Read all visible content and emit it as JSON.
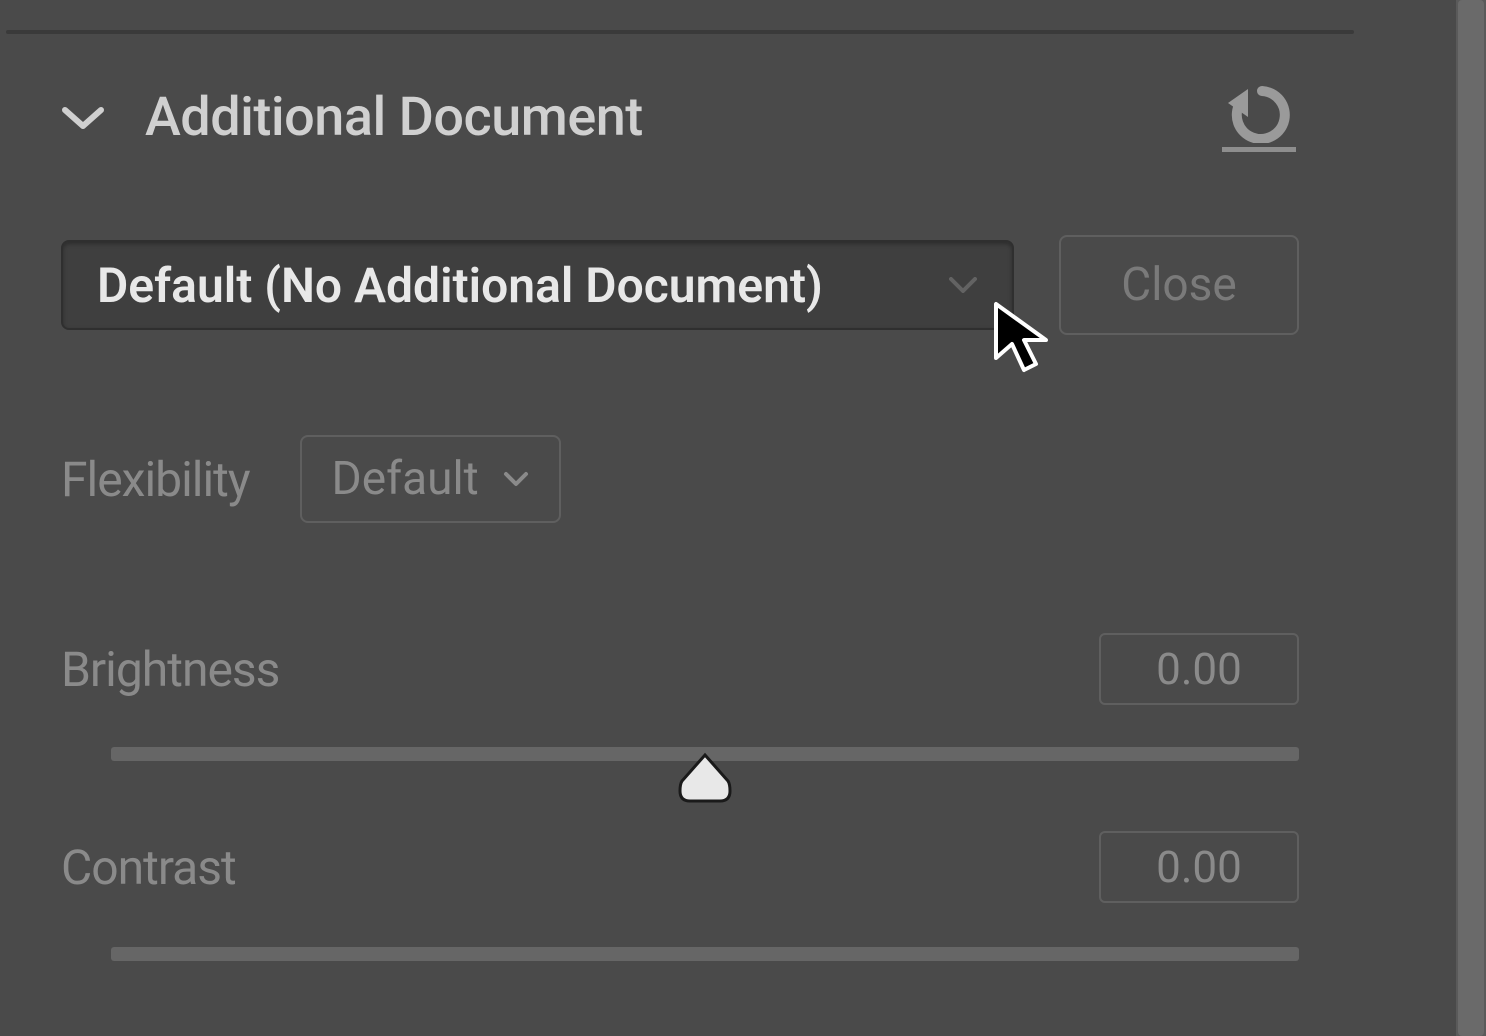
{
  "section": {
    "title": "Additional Document"
  },
  "document_dropdown": {
    "selected": "Default (No Additional Document)"
  },
  "close_button": {
    "label": "Close"
  },
  "flexibility": {
    "label": "Flexibility",
    "selected": "Default"
  },
  "sliders": {
    "brightness": {
      "label": "Brightness",
      "value": "0.00"
    },
    "contrast": {
      "label": "Contrast",
      "value": "0.00"
    }
  }
}
